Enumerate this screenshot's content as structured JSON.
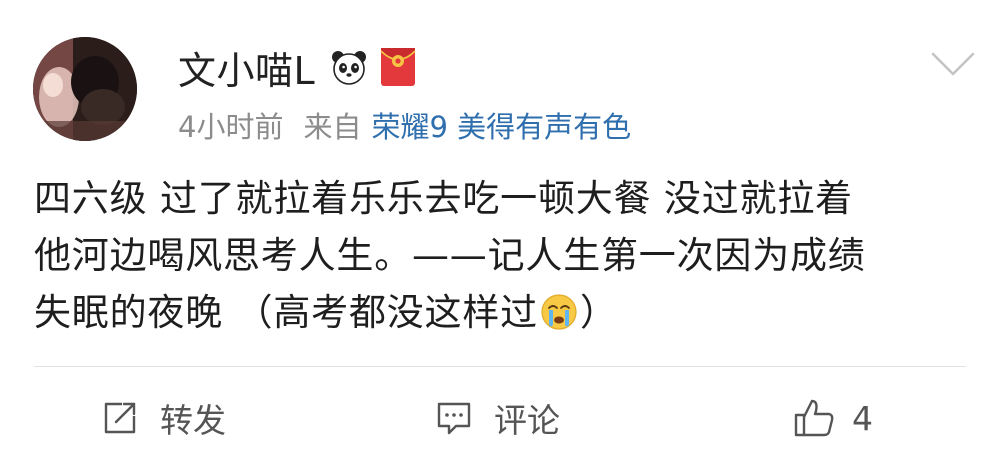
{
  "user": {
    "name": "文小喵L",
    "badges": [
      "panda-badge-icon",
      "red-packet-badge-icon"
    ]
  },
  "meta": {
    "time": "4小时前",
    "source_prefix": "来自",
    "device": "荣耀9 美得有声有色"
  },
  "content": {
    "lines": [
      "四六级 过了就拉着乐乐去吃一顿大餐 没过就拉着",
      "他河边喝风思考人生。——记人生第一次因为成绩",
      "失眠的夜晚 （高考都没这样过"
    ],
    "emoji": "crying-face-icon",
    "line3_tail": "）"
  },
  "actions": {
    "repost_label": "转发",
    "comment_label": "评论",
    "like_count": "4"
  },
  "colors": {
    "link_blue": "#2f6fae",
    "meta_gray": "#8c8c8c",
    "text_dark": "#1e1e1e",
    "action_gray": "#555555",
    "red_packet": "#e4393c",
    "gold": "#f5c543"
  }
}
